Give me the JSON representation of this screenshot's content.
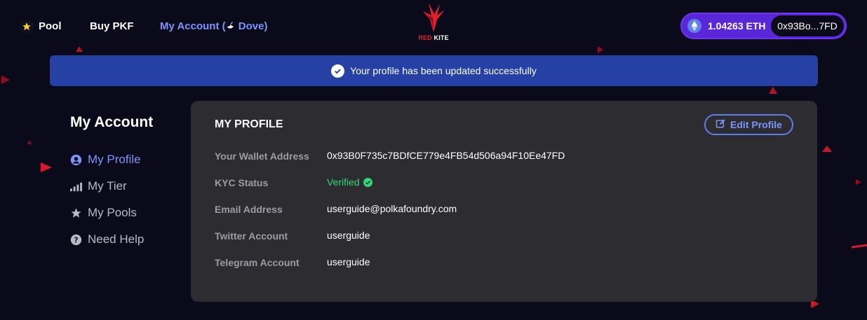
{
  "nav": {
    "pool": "Pool",
    "buy": "Buy PKF",
    "account_prefix": "My Account (",
    "account_tier": "Dove",
    "account_suffix": ")"
  },
  "logo": {
    "red": "RED",
    "white": "KITE"
  },
  "wallet": {
    "balance": "1.04263 ETH",
    "address_short": "0x93Bo...7FD"
  },
  "banner": {
    "message": "Your profile has been updated successfully"
  },
  "sidebar": {
    "title": "My Account",
    "items": [
      {
        "label": "My Profile",
        "icon": "user-circle-icon"
      },
      {
        "label": "My Tier",
        "icon": "signal-bars-icon"
      },
      {
        "label": "My Pools",
        "icon": "star-icon"
      },
      {
        "label": "Need Help",
        "icon": "question-circle-icon"
      }
    ]
  },
  "profile": {
    "title": "MY PROFILE",
    "edit_label": "Edit Profile",
    "rows": [
      {
        "label": "Your Wallet Address",
        "value": "0x93B0F735c7BDfCE779e4FB54d506a94F10Ee47FD"
      },
      {
        "label": "KYC Status",
        "value": "Verified"
      },
      {
        "label": "Email Address",
        "value": "userguide@polkafoundry.com"
      },
      {
        "label": "Twitter Account",
        "value": "userguide"
      },
      {
        "label": "Telegram Account",
        "value": "userguide"
      }
    ]
  },
  "colors": {
    "background": "#0b0a1a",
    "accent": "#7c94ff",
    "banner": "#2541a6",
    "card": "#2c2c31",
    "wallet_pill": "#5a27d8",
    "verified": "#2fd97a",
    "brand_red": "#e0202e"
  }
}
